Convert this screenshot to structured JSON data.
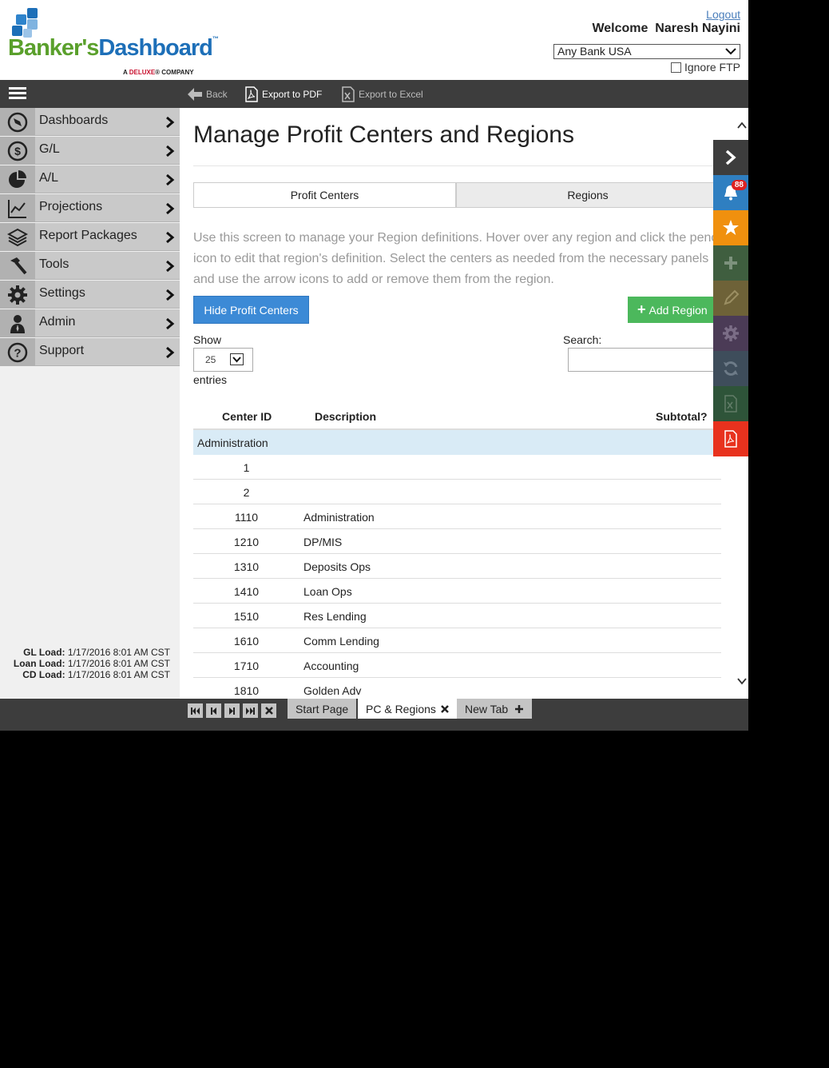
{
  "header": {
    "logo_brand_1": "Banker's",
    "logo_brand_2": "Dashboard",
    "logo_tm": "™",
    "logo_deluxe_a": "A ",
    "logo_deluxe_brand": "DELUXE",
    "logo_deluxe_company": "® COMPANY",
    "logout": "Logout",
    "welcome": "Welcome  Naresh Nayini",
    "bank": "Any Bank USA",
    "ignore_ftp": "Ignore FTP"
  },
  "toolbar": {
    "back": "Back",
    "export_pdf": "Export to PDF",
    "export_excel": "Export to Excel"
  },
  "sidebar": {
    "items": [
      {
        "label": "Dashboards",
        "icon": "compass-icon"
      },
      {
        "label": "G/L",
        "icon": "dollar-icon"
      },
      {
        "label": "A/L",
        "icon": "pie-icon"
      },
      {
        "label": "Projections",
        "icon": "line-chart-icon"
      },
      {
        "label": "Report Packages",
        "icon": "layers-icon"
      },
      {
        "label": "Tools",
        "icon": "hammer-icon"
      },
      {
        "label": "Settings",
        "icon": "gear-icon"
      },
      {
        "label": "Admin",
        "icon": "person-icon"
      },
      {
        "label": "Support",
        "icon": "question-icon"
      }
    ],
    "loads": [
      {
        "label": "GL Load:",
        "value": "1/17/2016 8:01 AM CST"
      },
      {
        "label": "Loan Load:",
        "value": "1/17/2016 8:01 AM CST"
      },
      {
        "label": "CD Load:",
        "value": "1/17/2016 8:01 AM CST"
      }
    ]
  },
  "main": {
    "title": "Manage Profit Centers and Regions",
    "tabs": [
      {
        "label": "Profit Centers"
      },
      {
        "label": "Regions"
      }
    ],
    "description": "Use this screen to manage your Region definitions. Hover over any region and click the pencil icon to edit that region's definition. Select the centers as needed from the necessary panels and use the arrow icons to add or remove them from the region.",
    "hide_button": "Hide Profit Centers",
    "add_region": "Add Region",
    "show_label": "Show",
    "entries_value": "25",
    "entries_label": "entries",
    "search_label": "Search:",
    "columns": {
      "center_id": "Center ID",
      "description": "Description",
      "subtotal": "Subtotal?"
    },
    "group": "Administration",
    "rows": [
      {
        "id": "1",
        "desc": ""
      },
      {
        "id": "2",
        "desc": ""
      },
      {
        "id": "1110",
        "desc": "Administration"
      },
      {
        "id": "1210",
        "desc": "DP/MIS"
      },
      {
        "id": "1310",
        "desc": "Deposits Ops"
      },
      {
        "id": "1410",
        "desc": "Loan Ops"
      },
      {
        "id": "1510",
        "desc": "Res Lending"
      },
      {
        "id": "1610",
        "desc": "Comm Lending"
      },
      {
        "id": "1710",
        "desc": "Accounting"
      },
      {
        "id": "1810",
        "desc": "Golden Adv"
      }
    ]
  },
  "action_bar": {
    "notification_count": "88",
    "colors": {
      "toggle": "#3d3d3d",
      "notify": "#2f7fc1",
      "star": "#f0900e",
      "add": "#3f5e3f",
      "edit": "#6e6238",
      "settings": "#4b3b56",
      "refresh": "#3e4d5b",
      "excel": "#2e5439",
      "pdf": "#e8321e"
    }
  },
  "bottom_tabs": {
    "start": "Start Page",
    "current": "PC & Regions",
    "new": "New Tab"
  }
}
